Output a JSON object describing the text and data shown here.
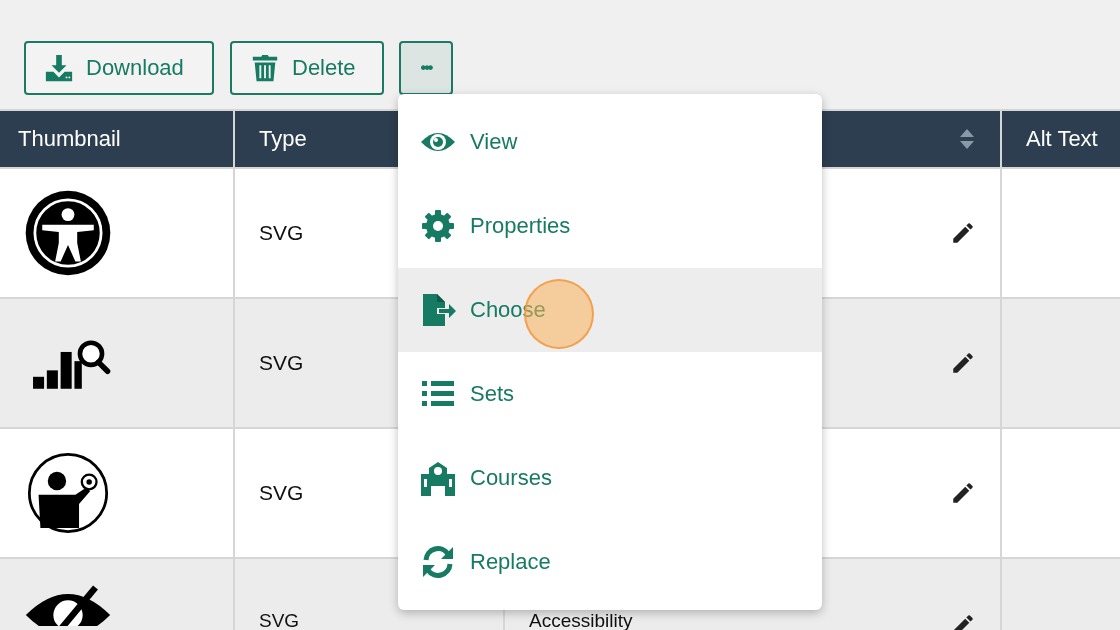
{
  "toolbar": {
    "buttons": [
      {
        "kind": "download",
        "label": "Download"
      },
      {
        "kind": "delete",
        "label": "Delete"
      }
    ],
    "more_button": {
      "label": "•••",
      "expanded": true
    }
  },
  "table": {
    "columns": [
      {
        "label": "Thumbnail"
      },
      {
        "label": "Type"
      },
      {
        "sortable": true
      },
      {
        "label": "Alt Text"
      }
    ],
    "rows": [
      {
        "kind": "accessibility",
        "type": "SVG"
      },
      {
        "kind": "chart-search",
        "type": "SVG"
      },
      {
        "kind": "person-globe",
        "type": "SVG"
      },
      {
        "kind": "eye-slash",
        "type": "SVG",
        "column_3": "Accessibility"
      }
    ]
  },
  "menu": {
    "items": [
      {
        "kind": "view",
        "label": "View",
        "selected": false
      },
      {
        "kind": "properties",
        "label": "Properties",
        "selected": false
      },
      {
        "kind": "choose",
        "label": "Choose",
        "selected": true
      },
      {
        "kind": "sets",
        "label": "Sets",
        "selected": false
      },
      {
        "kind": "courses",
        "label": "Courses",
        "selected": false
      },
      {
        "kind": "replace",
        "label": "Replace",
        "selected": false
      }
    ]
  },
  "click_indicator": true
}
